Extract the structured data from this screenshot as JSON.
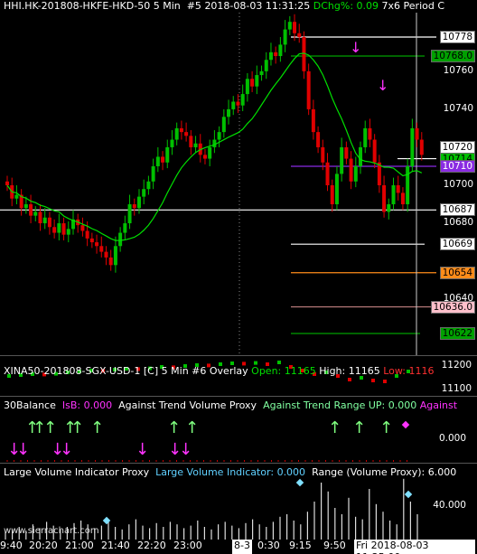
{
  "header": {
    "symbol": "HHI.HK-201808-HKFE-HKD-50",
    "interval": "5 Min",
    "chart_num": "#5",
    "datetime": "2018-08-03 11:31:25",
    "dchg_label": "DChg%:",
    "dchg_value": "0.09",
    "period_text": "7x6 Period C"
  },
  "price_levels": [
    {
      "text": "10778",
      "value": 10778,
      "bg": "#ffffff",
      "fg": "#000000"
    },
    {
      "text": "10768.0",
      "value": 10768,
      "bg": "#00a000",
      "fg": "#000000"
    },
    {
      "text": "10760",
      "value": 10760,
      "bg": "",
      "fg": "#ffffff"
    },
    {
      "text": "10740",
      "value": 10740,
      "bg": "",
      "fg": "#ffffff"
    },
    {
      "text": "10720",
      "value": 10720,
      "bg": "#ffffff",
      "fg": "#000000"
    },
    {
      "text": "10714",
      "value": 10714,
      "bg": "#00c000",
      "fg": "#000000"
    },
    {
      "text": "10710",
      "value": 10710,
      "bg": "#8a2be2",
      "fg": "#ffffff"
    },
    {
      "text": "10700",
      "value": 10700,
      "bg": "",
      "fg": "#ffffff"
    },
    {
      "text": "10687",
      "value": 10687,
      "bg": "#ffffff",
      "fg": "#000000"
    },
    {
      "text": "10680",
      "value": 10680,
      "bg": "",
      "fg": "#ffffff"
    },
    {
      "text": "10669",
      "value": 10669,
      "bg": "#ffffff",
      "fg": "#000000"
    },
    {
      "text": "10654",
      "value": 10654,
      "bg": "#ff8c1a",
      "fg": "#000000"
    },
    {
      "text": "10640",
      "value": 10640,
      "bg": "",
      "fg": "#ffffff"
    },
    {
      "text": "10636.0",
      "value": 10636,
      "bg": "#ffc0cb",
      "fg": "#000000"
    },
    {
      "text": "10622",
      "value": 10622,
      "bg": "#00a000",
      "fg": "#000000"
    }
  ],
  "overlay": {
    "title": "XINA50-201808-SGX-USD-1 [C]",
    "interval": "5 Min",
    "num": "#6 Overlay",
    "open_label": "Open:",
    "open": "11165",
    "high_label": "High:",
    "high": "11165",
    "low_label": "Low:",
    "low": "1116",
    "axis": [
      "11200",
      "11100"
    ]
  },
  "balance": {
    "title": "30Balance",
    "isb": "IsB: 0.000",
    "proxy": "Against Trend Volume Proxy",
    "range": "Against Trend Range UP: 0.000",
    "against": "Against",
    "axis": "0.000"
  },
  "volume": {
    "title": "Large Volume Indicator Proxy",
    "indicator": "Large Volume Indicator: 0.000",
    "range": "Range (Volume Proxy): 6.000",
    "axis": "40.000"
  },
  "time_axis": [
    "9:40",
    "20:20",
    "21:00",
    "21:40",
    "22:20",
    "23:00",
    "8-3",
    "0:30",
    "9:15",
    "9:50",
    "Fri 2018-08-03  11:25:00"
  ],
  "watermark": "www.sierrachart.com",
  "colors": {
    "up": "#00c000",
    "down": "#e00000",
    "ma": "#00e000",
    "magenta": "#ff33ff",
    "lightgreen": "#80ff80"
  }
}
